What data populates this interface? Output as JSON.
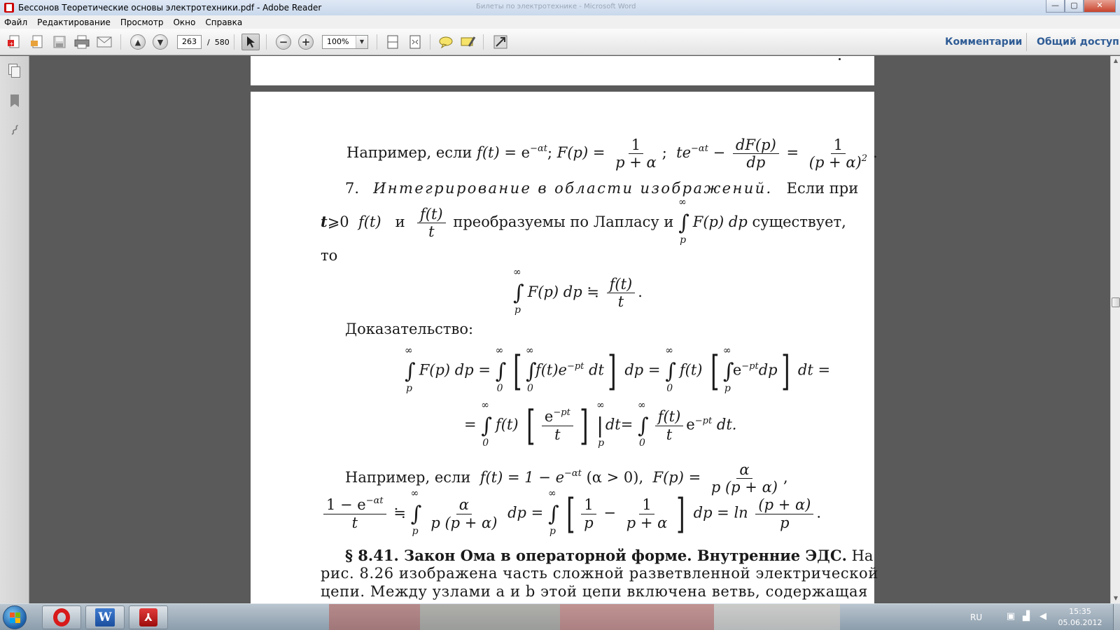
{
  "window": {
    "title": "Бессонов Теоретические основы электротехники.pdf - Adobe Reader",
    "background_title": "Билеты по электротехнике - Microsoft Word",
    "buttons": {
      "minimize": "—",
      "maximize": "▢",
      "close": "✕"
    }
  },
  "menu": [
    "Файл",
    "Редактирование",
    "Просмотр",
    "Окно",
    "Справка"
  ],
  "toolbar": {
    "current_page": "263",
    "page_separator": "/",
    "total_pages": "580",
    "zoom": "100%",
    "comments_label": "Комментарии",
    "share_label": "Общий доступ"
  },
  "document": {
    "line1": {
      "prefix": "Например, если",
      "ft": "f(t)",
      "eq1": "=",
      "e_at": "e",
      "e_at_sup": "−αt",
      "sep1": ";",
      "Fp": "F(p)",
      "eq2": "=",
      "frac1_num": "1",
      "frac1_den": "p + α",
      "sep2": ";",
      "te": "te",
      "te_sup": "−αt",
      "arrow": "−",
      "frac2_num": "dF(p)",
      "frac2_den": "dp",
      "eq3": "=",
      "frac3_num": "1",
      "frac3_den": "(p + α)",
      "frac3_den_sup": "2",
      "end": "."
    },
    "para7": {
      "number": "7.",
      "italic_heading": "Интегрирование в области изображений.",
      "rest": "Если при",
      "cond_t": "t",
      "cond_ge": "⩾0",
      "cond_ft": "f(t)",
      "cond_and": "и",
      "cond_frac_num": "f(t)",
      "cond_frac_den": "t",
      "cond_text": "преобразуемы по Лапласу и",
      "int_upper": "∞",
      "int_lower": "p",
      "int_body": "F(p) dp",
      "cond_end": "существует,",
      "to": "то"
    },
    "formula_main": {
      "int_upper": "∞",
      "int_lower": "p",
      "body": "F(p) dp",
      "rel": "≒",
      "frac_num": "f(t)",
      "frac_den": "t",
      "end": "."
    },
    "proof_label": "Доказательство:",
    "proof_line1": {
      "i1_up": "∞",
      "i1_lo": "p",
      "b1": "F(p) dp =",
      "i2_up": "∞",
      "i2_lo": "0",
      "i3_up": "∞",
      "i3_lo": "0",
      "b3": "f(t)e",
      "b3_sup": "−pt",
      "b3_end": "dt",
      "mid": "dp =",
      "i4_up": "∞",
      "i4_lo": "0",
      "b4": "f(t)",
      "i5_up": "∞",
      "i5_lo": "p",
      "b5": "e",
      "b5_sup": "−pt",
      "b5_end": "dp",
      "end": "dt ="
    },
    "proof_line2": {
      "start": "=",
      "i1_up": "∞",
      "i1_lo": "0",
      "b1": "f(t)",
      "frac_num": "e",
      "frac_num_sup": "−pt",
      "frac_den": "t",
      "eval_up": "∞",
      "eval_lo": "p",
      "mid": "dt=",
      "i2_up": "∞",
      "i2_lo": "0",
      "frac2_num": "f(t)",
      "frac2_den": "t",
      "b2": "e",
      "b2_sup": "−pt",
      "end": "dt."
    },
    "example2": {
      "prefix": "Например, если",
      "ft": "f(t) = 1 − e",
      "ft_sup": "−αt",
      "cond": "(α > 0),",
      "Fp": "F(p) =",
      "frac_num": "α",
      "frac_den": "p (p + α)",
      "end": ","
    },
    "example2_line2": {
      "f1_num": "1 − e",
      "f1_num_sup": "−αt",
      "f1_den": "t",
      "rel": "≒",
      "i1_up": "∞",
      "i1_lo": "p",
      "f2_num": "α",
      "f2_den": "p (p + α)",
      "mid1": "dp =",
      "i2_up": "∞",
      "i2_lo": "p",
      "f3_num": "1",
      "f3_den": "p",
      "minus": "−",
      "f4_num": "1",
      "f4_den": "p + α",
      "mid2": "dp = ln",
      "f5_num": "(p + α)",
      "f5_den": "p",
      "end": "."
    },
    "section": {
      "heading": "§ 8.41. Закон Ома в операторной форме. Внутренние ЭДС.",
      "text1": "На",
      "line2": "рис. 8.26 изображена часть сложной разветвленной электрической",
      "line3": "цепи. Между узлами a и b этой цепи включена ветвь, содержащая"
    }
  },
  "taskbar": {
    "language": "RU",
    "time": "15:35",
    "date": "05.06.2012"
  }
}
